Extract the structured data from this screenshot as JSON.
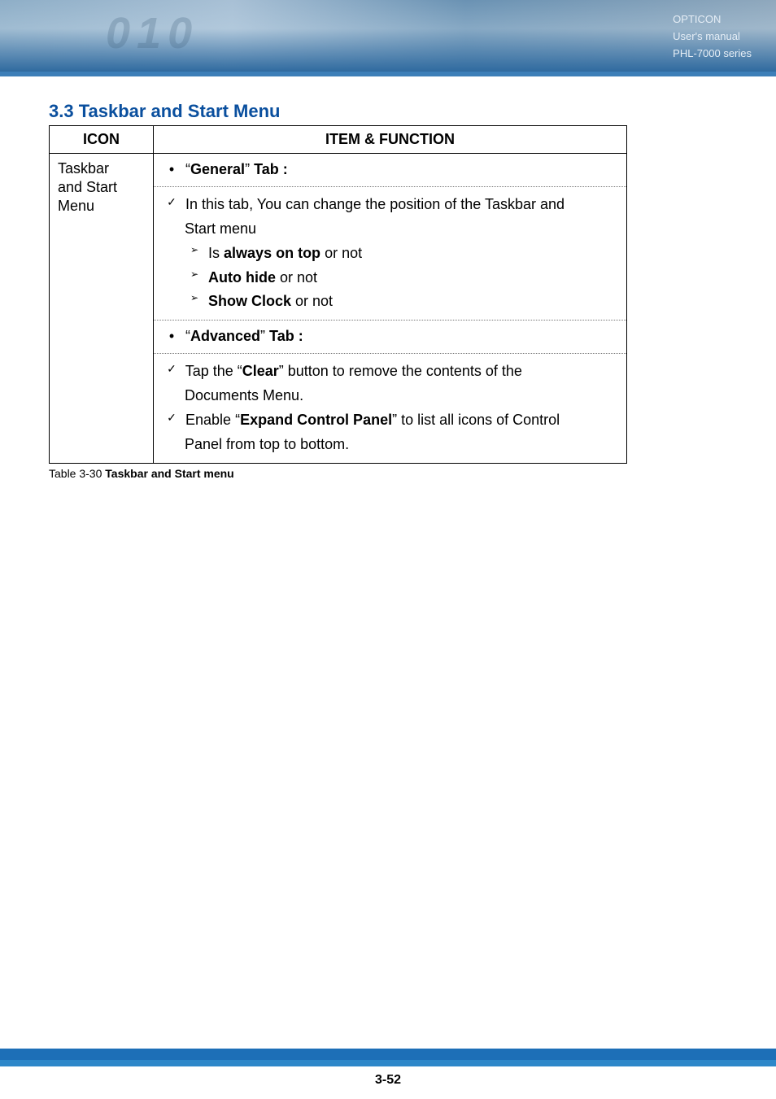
{
  "header": {
    "line1": "OPTICON",
    "line2": "User's manual",
    "line3": "PHL-7000 series",
    "deco_digits": "010"
  },
  "section_title": "3.3 Taskbar and Start Menu",
  "table": {
    "headers": {
      "icon": "ICON",
      "item": "ITEM & FUNCTION"
    },
    "icon_cell": {
      "l1": "Taskbar",
      "l2": "and Start",
      "l3": "Menu"
    },
    "general_tab_prefix": "“",
    "general_tab_word": "General",
    "general_tab_suffix": "” ",
    "general_tab_label": "Tab :",
    "gen_line1_a": "In this tab, You can change the position of the Taskbar and",
    "gen_line1_b": "Start menu",
    "gen_sub1_a": "Is ",
    "gen_sub1_b": "always on top",
    "gen_sub1_c": " or not",
    "gen_sub2_a": "Auto hide",
    "gen_sub2_b": " or not",
    "gen_sub3_a": "Show Clock",
    "gen_sub3_b": " or not",
    "advanced_tab_prefix": "“",
    "advanced_tab_word": "Advanced",
    "advanced_tab_suffix": "” ",
    "advanced_tab_label": "Tab :",
    "adv_line1_a": "Tap the “",
    "adv_line1_b": "Clear",
    "adv_line1_c": "” button to remove the contents of the",
    "adv_line1_d": "Documents Menu.",
    "adv_line2_a": "Enable “",
    "adv_line2_b": "Expand Control Panel",
    "adv_line2_c": "” to list all icons of Control",
    "adv_line2_d": "Panel from top to bottom."
  },
  "caption": {
    "label": "Table 3-30 ",
    "title": "Taskbar and Start menu"
  },
  "page_number": "3-52"
}
